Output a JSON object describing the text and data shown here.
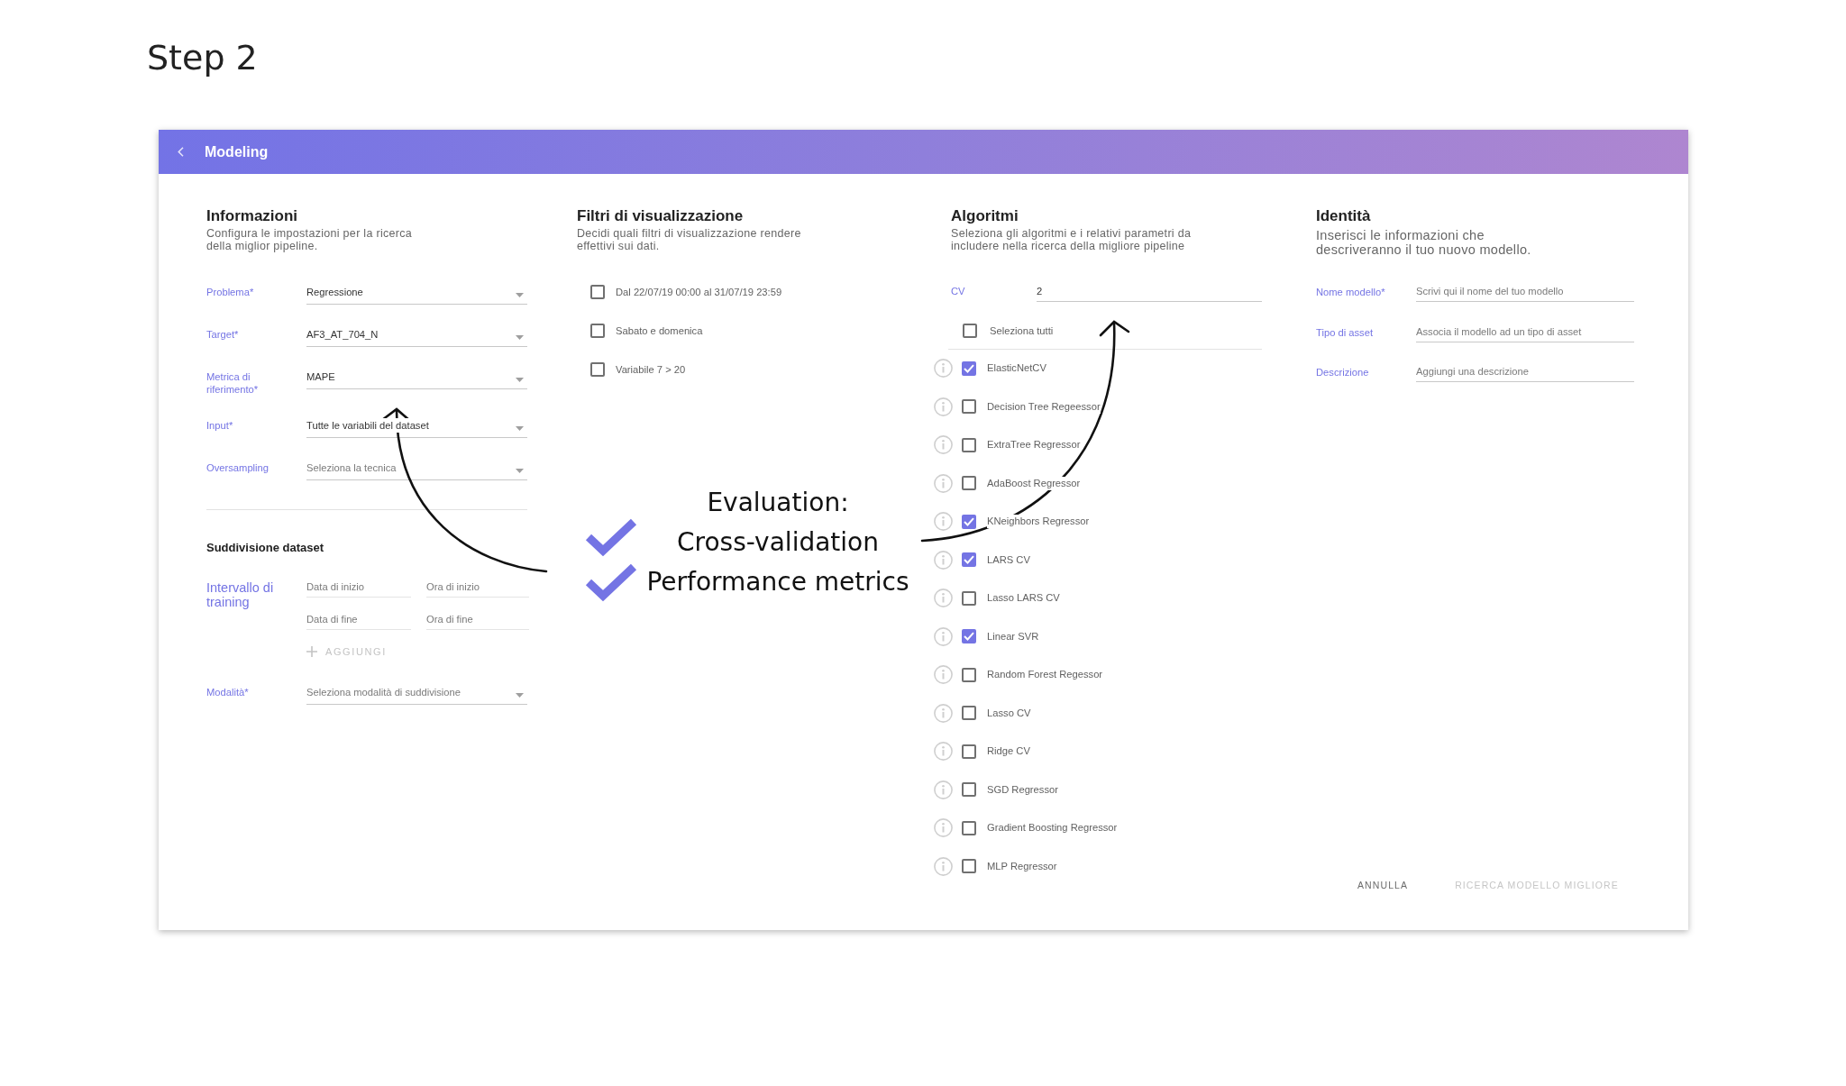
{
  "page_title": "Step 2",
  "window": {
    "title": "Modeling"
  },
  "informazioni": {
    "title": "Informazioni",
    "description": "Configura le impostazioni per la ricerca\ndella miglior pipeline.",
    "fields": [
      {
        "label": "Problema*",
        "value": "Regressione"
      },
      {
        "label": "Target*",
        "value": "AF3_AT_704_N"
      },
      {
        "label": "Metrica di riferimento*",
        "value": "MAPE"
      },
      {
        "label": "Input*",
        "value": "Tutte le variabili del dataset"
      },
      {
        "label": "Oversampling",
        "placeholder": "Seleziona la tecnica"
      }
    ]
  },
  "suddivisione_dataset": {
    "title": "Suddivisione dataset",
    "interval": {
      "label": "Intervallo di training",
      "fields": [
        {
          "placeholder": "Data di inizio"
        },
        {
          "placeholder": "Ora di inizio"
        },
        {
          "placeholder": "Data di fine"
        },
        {
          "placeholder": "Ora di fine"
        }
      ],
      "add_button": {
        "label": "AGGIUNGI",
        "disabled": true
      }
    },
    "mode": {
      "label": "Modalità*",
      "placeholder": "Seleziona modalità di suddivisione"
    }
  },
  "filtri": {
    "title": "Filtri di visualizzazione",
    "description": "Decidi quali filtri di visualizzazione rendere\neffettivi sui dati.",
    "items": [
      {
        "label": "Dal 22/07/19 00:00 al 31/07/19 23:59",
        "checked": false
      },
      {
        "label": "Sabato e domenica",
        "checked": false
      },
      {
        "label": "Variabile 7 > 20",
        "checked": false
      }
    ]
  },
  "annotation": {
    "lines": [
      {
        "text": "Evaluation:",
        "ticked": false
      },
      {
        "text": "Cross-validation",
        "ticked": true
      },
      {
        "text": "Performance metrics",
        "ticked": true
      }
    ]
  },
  "algoritmi": {
    "title": "Algoritmi",
    "description": "Seleziona gli algoritmi e i relativi parametri da\nincludere nella ricerca della migliore pipeline",
    "cv": {
      "label": "CV",
      "value": "2"
    },
    "select_all": {
      "label": "Seleziona tutti",
      "checked": false
    },
    "items": [
      {
        "name": "ElasticNetCV",
        "checked": true
      },
      {
        "name": "Decision Tree Regeessor",
        "checked": false
      },
      {
        "name": "ExtraTree Regressor",
        "checked": false
      },
      {
        "name": "AdaBoost Regressor",
        "checked": false
      },
      {
        "name": "KNeighbors Regressor",
        "checked": true
      },
      {
        "name": "LARS CV",
        "checked": true
      },
      {
        "name": "Lasso LARS CV",
        "checked": false
      },
      {
        "name": "Linear SVR",
        "checked": true
      },
      {
        "name": "Random Forest Regessor",
        "checked": false
      },
      {
        "name": "Lasso CV",
        "checked": false
      },
      {
        "name": "Ridge CV",
        "checked": false
      },
      {
        "name": "SGD Regressor",
        "checked": false
      },
      {
        "name": "Gradient Boosting Regressor",
        "checked": false
      },
      {
        "name": "MLP Regressor",
        "checked": false
      }
    ]
  },
  "identita": {
    "title": "Identità",
    "description": "Inserisci le informazioni che\ndescriveranno il tuo nuovo modello.",
    "fields": [
      {
        "label": "Nome modello*",
        "placeholder": "Scrivi qui il nome del tuo modello"
      },
      {
        "label": "Tipo di asset",
        "placeholder": "Associa il modello ad un tipo di asset"
      },
      {
        "label": "Descrizione",
        "placeholder": "Aggiungi una descrizione"
      }
    ]
  },
  "actions": [
    {
      "label": "ANNULLA",
      "disabled": false
    },
    {
      "label": "RICERCA MODELLO MIGLIORE",
      "disabled": true
    }
  ]
}
